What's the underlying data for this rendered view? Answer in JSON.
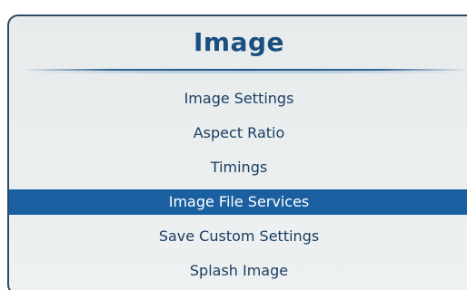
{
  "menu": {
    "title": "Image",
    "items": [
      {
        "label": "Image Settings",
        "selected": false
      },
      {
        "label": "Aspect Ratio",
        "selected": false
      },
      {
        "label": "Timings",
        "selected": false
      },
      {
        "label": "Image File Services",
        "selected": true
      },
      {
        "label": "Save Custom Settings",
        "selected": false
      },
      {
        "label": "Splash Image",
        "selected": false
      }
    ]
  },
  "colors": {
    "title": "#1b4f80",
    "item_text": "#1a3e63",
    "selected_background": "#1a60a0",
    "selected_text": "#ffffff",
    "panel_background": "#e9edee",
    "border": "#2a4a66"
  }
}
